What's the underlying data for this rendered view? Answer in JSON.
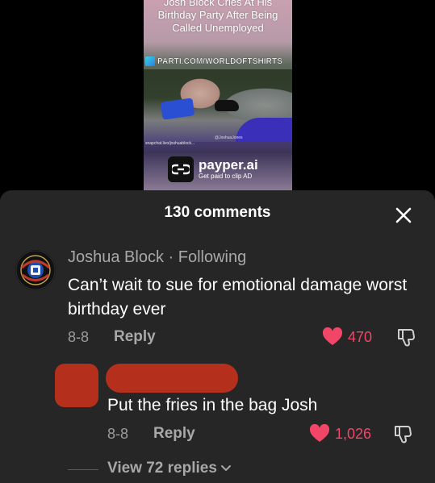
{
  "video": {
    "caption_top": "Josh Block Cries At His",
    "caption_line2": "Birthday Party After Being",
    "caption_line3": "Called Unemployed",
    "handle_banner": "PARTI.COM/WORLDOFTSHIRTS",
    "small_url": "snapchat.livo/joshuablock...",
    "watermark": "@JoshuaJones",
    "sponsor_name": "payper.ai",
    "sponsor_tag": "Get paid to clip AD"
  },
  "panel": {
    "title": "130 comments"
  },
  "comment": {
    "author": "Joshua Block · Following",
    "text": "Can’t wait to sue for emotional damage worst birthday ever",
    "date": "8-8",
    "reply_label": "Reply",
    "likes": "470"
  },
  "reply": {
    "text": "Put the fries in the bag Josh",
    "date": "8-8",
    "reply_label": "Reply",
    "likes": "1,026"
  },
  "view_more": "View 72 replies",
  "colors": {
    "panel_bg": "#262626",
    "like_red": "#f14668",
    "redaction": "#b5301c",
    "muted_text": "#a8a8a8"
  },
  "icons": [
    "close-icon",
    "heart-icon",
    "dislike-icon",
    "chevron-down-icon",
    "payper-logo-icon"
  ]
}
